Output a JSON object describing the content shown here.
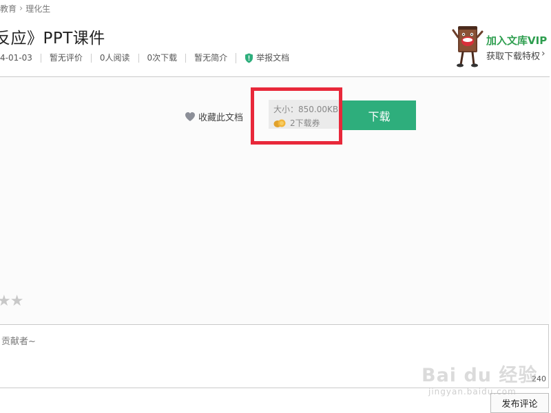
{
  "breadcrumb": {
    "item1": "教育",
    "item2": "理化生"
  },
  "title": "反应》PPT课件",
  "meta": {
    "date": "4-01-03",
    "rating": "暂无评价",
    "reads": "0人阅读",
    "downloads": "0次下载",
    "intro": "暂无简介",
    "report": "举报文档"
  },
  "vip": {
    "title": "加入文库VIP",
    "subtitle": "获取下载特权"
  },
  "download": {
    "favorite": "收藏此文档",
    "size": "大小：850.00KB",
    "coupons": "2下载券",
    "button": "下载"
  },
  "comment": {
    "placeholder": "贡献者~",
    "count": "240",
    "submit": "发布评论"
  },
  "watermark": {
    "logo": "Bai du 经验",
    "url": "jingyan.baidu.com"
  },
  "colors": {
    "accent_green": "#2eae7c",
    "highlight_red": "#e8283a",
    "vip_green": "#2e9e4f"
  },
  "icons": {
    "favorite": "heart-icon",
    "report": "shield-icon",
    "coupon": "coin-icon",
    "arrow": "chevron-right-icon"
  }
}
